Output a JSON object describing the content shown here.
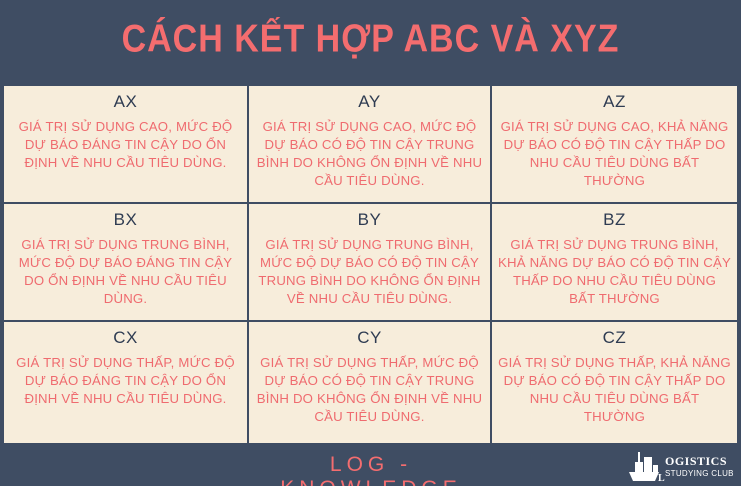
{
  "header": {
    "title": "CÁCH KẾT HỢP ABC VÀ XYZ"
  },
  "cells": [
    {
      "code": "AX",
      "description": "GIÁ TRỊ SỬ DỤNG CAO, MỨC ĐỘ DỰ BÁO ĐÁNG TIN CẬY DO ỔN ĐỊNH VỀ NHU CẦU TIÊU DÙNG."
    },
    {
      "code": "AY",
      "description": "GIÁ TRỊ SỬ DỤNG CAO, MỨC ĐỘ DỰ BÁO CÓ ĐỘ TIN CẬY TRUNG BÌNH DO KHÔNG ỔN ĐỊNH VỀ NHU CẦU TIÊU DÙNG."
    },
    {
      "code": "AZ",
      "description": "GIÁ TRỊ SỬ DỤNG CAO, KHẢ NĂNG DỰ BÁO CÓ ĐỘ TIN CẬY THẤP DO NHU CẦU TIÊU DÙNG BẤT THƯỜNG"
    },
    {
      "code": "BX",
      "description": "GIÁ TRỊ SỬ DỤNG TRUNG BÌNH, MỨC ĐỘ DỰ BÁO ĐÁNG TIN CẬY DO ỔN ĐỊNH VỀ NHU CẦU TIÊU DÙNG."
    },
    {
      "code": "BY",
      "description": "GIÁ TRỊ SỬ DỤNG TRUNG BÌNH, MỨC ĐỘ DỰ BÁO CÓ ĐỘ TIN CẬY TRUNG BÌNH DO KHÔNG ỔN ĐỊNH VỀ NHU CẦU TIÊU DÙNG."
    },
    {
      "code": "BZ",
      "description": "GIÁ TRỊ SỬ DỤNG TRUNG BÌNH, KHẢ NĂNG DỰ BÁO CÓ ĐỘ TIN CẬY THẤP DO NHU CẦU TIÊU DÙNG BẤT THƯỜNG"
    },
    {
      "code": "CX",
      "description": "GIÁ TRỊ SỬ DỤNG THẤP, MỨC ĐỘ DỰ BÁO ĐÁNG TIN CẬY DO ỔN ĐỊNH VỀ NHU CẦU TIÊU DÙNG."
    },
    {
      "code": "CY",
      "description": "GIÁ TRỊ SỬ DỤNG THẤP, MỨC ĐỘ DỰ BÁO CÓ ĐỘ TIN CẬY TRUNG BÌNH DO KHÔNG ỔN ĐỊNH VỀ NHU CẦU TIÊU DÙNG."
    },
    {
      "code": "CZ",
      "description": "GIÁ TRỊ SỬ DỤNG THẤP, KHẢ NĂNG DỰ BÁO CÓ ĐỘ TIN CẬY THẤP DO NHU CẦU TIÊU DÙNG BẤT THƯỜNG"
    }
  ],
  "footer": {
    "text": "LOG - KNOWLEDGE",
    "logo_line1": "OGISTICS",
    "logo_initial": "L",
    "logo_line2": "STUDYING CLUB"
  },
  "colors": {
    "background": "#3f4d63",
    "accent": "#f46d6f",
    "panel": "#f7eddb"
  },
  "icons": {
    "logo": "ship-logo-icon"
  }
}
